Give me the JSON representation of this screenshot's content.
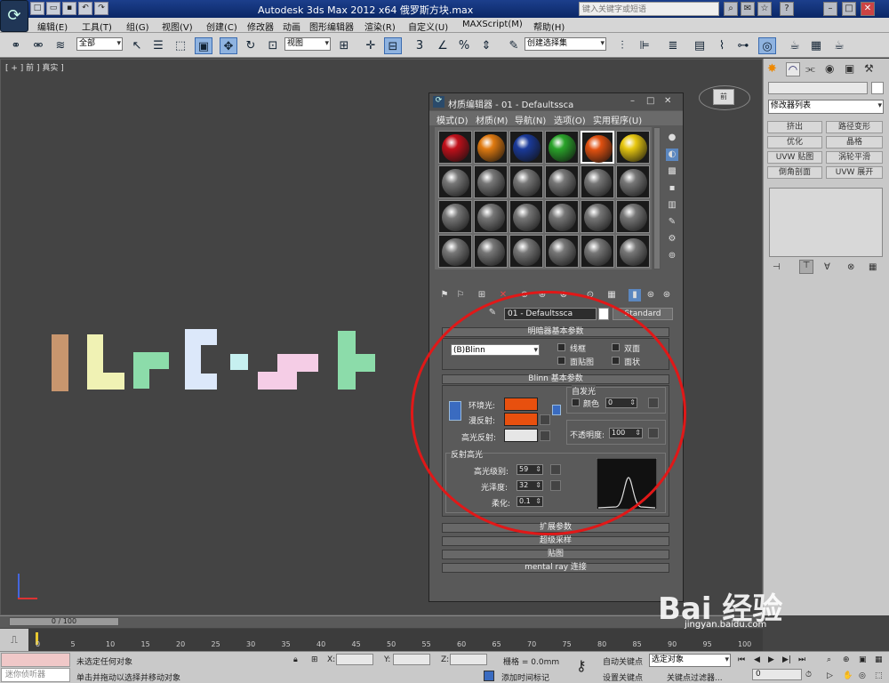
{
  "titlebar": {
    "title": "Autodesk 3ds Max  2012 x64   俄罗斯方块.max",
    "search_placeholder": "键入关键字或短语"
  },
  "menubar": [
    "编辑(E)",
    "工具(T)",
    "组(G)",
    "视图(V)",
    "创建(C)",
    "修改器",
    "动画",
    "图形编辑器",
    "渲染(R)",
    "自定义(U)",
    "MAXScript(M)",
    "帮助(H)"
  ],
  "toolbar": {
    "selection_filter": "全部",
    "ref_coord": "视图",
    "named_selection": "创建选择集"
  },
  "viewport": {
    "label": "[ + ] 前 ] 真实 ]",
    "colors": [
      "#c8966e",
      "#f0f2b4",
      "#8cdcaa",
      "#dce8fa",
      "#c6f0f0",
      "#f5cde6",
      "#8cdcaa"
    ]
  },
  "cmdpanel": {
    "modifier_list": "修改器列表",
    "buttons": [
      "挤出",
      "路径变形",
      "优化",
      "晶格",
      "UVW 贴图",
      "涡轮平滑",
      "倒角剖面",
      "UVW 展开"
    ]
  },
  "mateditor": {
    "title": "材质编辑器 - 01 - Defaultssca",
    "menu": [
      "模式(D)",
      "材质(M)",
      "导航(N)",
      "选项(O)",
      "实用程序(U)"
    ],
    "top_slot_colors": [
      "#c0101a",
      "#e07a10",
      "#1a3a9a",
      "#2aa42a",
      "#e05010",
      "#e8c810"
    ],
    "material_name": "01 - Defaultssca",
    "material_type": "Standard",
    "shader_rollout": "明暗器基本参数",
    "shader": "(B)Blinn",
    "wire": "线框",
    "two_sided": "双面",
    "face_map": "面贴图",
    "faceted": "面状",
    "blinn_rollout": "Blinn 基本参数",
    "self_illum_group": "自发光",
    "color_label": "颜色",
    "self_illum_value": "0",
    "ambient": "环境光:",
    "diffuse": "漫反射:",
    "specular": "高光反射:",
    "ambient_color": "#e8500e",
    "diffuse_color": "#e8500e",
    "specular_color": "#e6e6e6",
    "opacity_label": "不透明度:",
    "opacity": "100",
    "spec_highlights": "反射高光",
    "spec_level_label": "高光级别:",
    "spec_level": "59",
    "gloss_label": "光泽度:",
    "gloss": "32",
    "soften_label": "柔化:",
    "soften": "0.1",
    "rollouts": [
      "扩展参数",
      "超级采样",
      "贴图",
      "mental ray 连接"
    ]
  },
  "timeline": {
    "frame": "0 / 100",
    "ticks": [
      "0",
      "5",
      "10",
      "15",
      "20",
      "25",
      "30",
      "35",
      "40",
      "45",
      "50",
      "55",
      "60",
      "65",
      "70",
      "75",
      "80",
      "85",
      "90",
      "95",
      "100"
    ]
  },
  "statusbar": {
    "script_listener": "迷你侦听器",
    "status_line1": "未选定任何对象",
    "status_line2": "单击并拖动以选择并移动对象",
    "x_label": "X:",
    "y_label": "Y:",
    "z_label": "Z:",
    "grid": "栅格 = 0.0mm",
    "add_time_tag": "添加时间标记",
    "auto_key": "自动关键点",
    "selected_objects": "选定对象",
    "set_key": "设置关键点",
    "key_filters": "关键点过滤器...",
    "frame_value": "0"
  },
  "watermark": {
    "text": "Bai 经验",
    "url": "jingyan.baidu.com"
  }
}
